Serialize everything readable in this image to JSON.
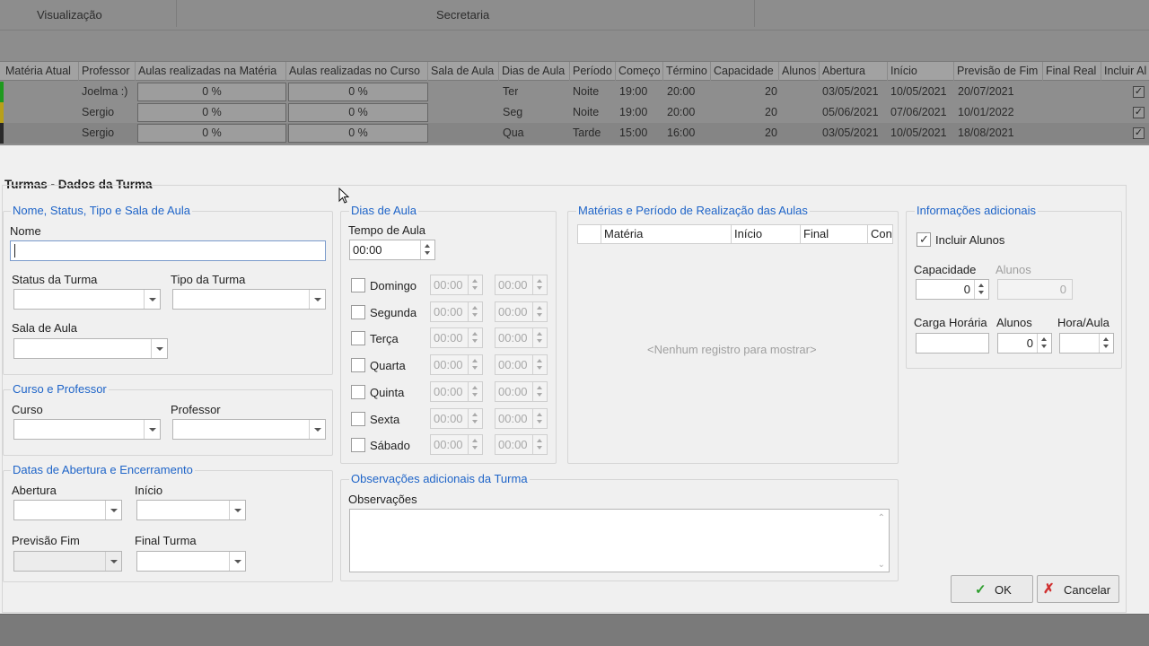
{
  "background": {
    "menu": [
      "Visualização",
      "Secretaria"
    ],
    "grid": {
      "headers": [
        "Matéria Atual",
        "Professor",
        "Aulas realizadas na Matéria",
        "Aulas realizadas no Curso",
        "Sala de Aula",
        "Dias de Aula",
        "Período",
        "Começo",
        "Término",
        "Capacidade",
        "Alunos",
        "Abertura",
        "Início",
        "Previsão de Fim",
        "Final Real",
        "Incluir Al"
      ],
      "rows": [
        {
          "professor": "Joelma :)",
          "aulas_materia": "0 %",
          "aulas_curso": "0 %",
          "dias": "Ter",
          "periodo": "Noite",
          "comeco": "19:00",
          "termino": "20:00",
          "capacidade": "20",
          "abertura": "03/05/2021",
          "inicio": "10/05/2021",
          "previsao": "20/07/2021",
          "incluir": "✓",
          "status_color": "#1f9a1f"
        },
        {
          "professor": "Sergio",
          "aulas_materia": "0 %",
          "aulas_curso": "0 %",
          "dias": "Seg",
          "periodo": "Noite",
          "comeco": "19:00",
          "termino": "20:00",
          "capacidade": "20",
          "abertura": "05/06/2021",
          "inicio": "07/06/2021",
          "previsao": "10/01/2022",
          "incluir": "✓",
          "status_color": "#b8a01a"
        },
        {
          "professor": "Sergio",
          "aulas_materia": "0 %",
          "aulas_curso": "0 %",
          "dias": "Qua",
          "periodo": "Tarde",
          "comeco": "15:00",
          "termino": "16:00",
          "capacidade": "20",
          "abertura": "03/05/2021",
          "inicio": "10/05/2021",
          "previsao": "18/08/2021",
          "incluir": "✓",
          "status_color": "#2a2a2a"
        }
      ]
    }
  },
  "dialog": {
    "title": "Turmas - Dados da Turma",
    "nome_group": {
      "title": "Nome, Status, Tipo e Sala de Aula",
      "nome_label": "Nome",
      "nome_value": "",
      "status_label": "Status da Turma",
      "tipo_label": "Tipo da Turma",
      "sala_label": "Sala de Aula"
    },
    "curso_group": {
      "title": "Curso e Professor",
      "curso_label": "Curso",
      "professor_label": "Professor"
    },
    "datas_group": {
      "title": "Datas de Abertura e Encerramento",
      "abertura_label": "Abertura",
      "inicio_label": "Início",
      "previsao_label": "Previsão Fim",
      "final_label": "Final Turma"
    },
    "dias_group": {
      "title": "Dias de Aula",
      "tempo_label": "Tempo de Aula",
      "tempo_value": "00:00",
      "days": [
        {
          "name": "Domingo",
          "start": "00:00",
          "end": "00:00"
        },
        {
          "name": "Segunda",
          "start": "00:00",
          "end": "00:00"
        },
        {
          "name": "Terça",
          "start": "00:00",
          "end": "00:00"
        },
        {
          "name": "Quarta",
          "start": "00:00",
          "end": "00:00"
        },
        {
          "name": "Quinta",
          "start": "00:00",
          "end": "00:00"
        },
        {
          "name": "Sexta",
          "start": "00:00",
          "end": "00:00"
        },
        {
          "name": "Sábado",
          "start": "00:00",
          "end": "00:00"
        }
      ]
    },
    "materias_group": {
      "title": "Matérias e Período de Realização das Aulas",
      "columns": [
        "Matéria",
        "Início",
        "Final",
        "Con"
      ],
      "empty_text": "<Nenhum registro para mostrar>"
    },
    "obs_group": {
      "title": "Observações adicionais da Turma",
      "obs_label": "Observações",
      "obs_value": ""
    },
    "info_group": {
      "title": "Informações adicionais",
      "incluir_label": "Incluir Alunos",
      "incluir_checked": true,
      "capacidade_label": "Capacidade",
      "capacidade_value": "0",
      "alunos_label": "Alunos",
      "alunos_value": "0",
      "carga_label": "Carga Horária",
      "carga_value": "",
      "alunos2_label": "Alunos",
      "alunos2_value": "0",
      "hora_label": "Hora/Aula",
      "hora_value": ""
    },
    "buttons": {
      "ok": "OK",
      "cancel": "Cancelar"
    }
  }
}
